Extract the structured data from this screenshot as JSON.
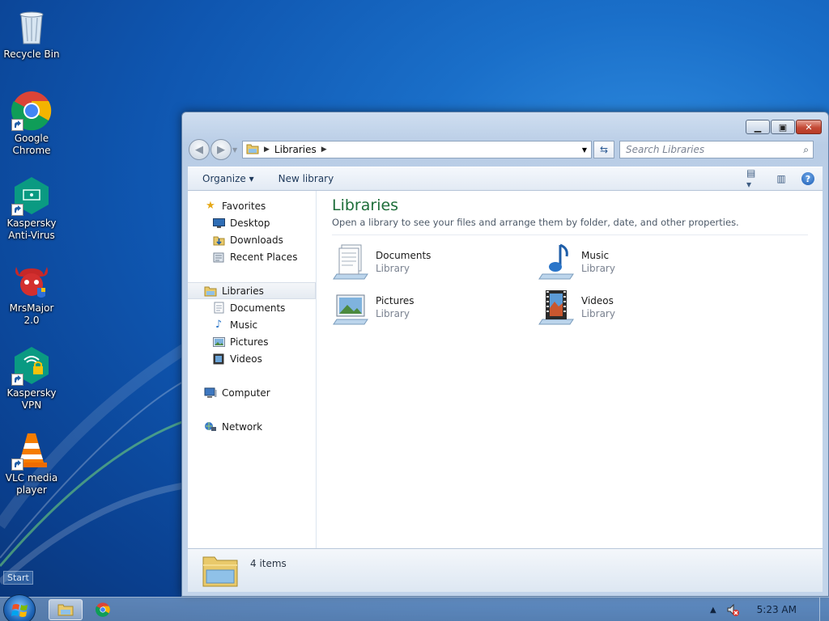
{
  "desktop": {
    "icons": [
      {
        "label": "Recycle Bin",
        "icon": "recycle-bin-icon"
      },
      {
        "label": "Google Chrome",
        "icon": "chrome-icon"
      },
      {
        "label": "Kaspersky Anti-Virus",
        "icon": "kaspersky-antivirus-icon"
      },
      {
        "label": "MrsMajor 2.0",
        "icon": "mrsmajor-icon"
      },
      {
        "label": "Kaspersky VPN",
        "icon": "kaspersky-vpn-icon"
      },
      {
        "label": "VLC media player",
        "icon": "vlc-icon"
      }
    ],
    "start_tooltip": "Start"
  },
  "window": {
    "address": {
      "crumb": "Libraries"
    },
    "search": {
      "placeholder": "Search Libraries"
    },
    "toolbar": {
      "organize": "Organize",
      "new_library": "New library"
    },
    "nav": {
      "favorites": {
        "label": "Favorites",
        "items": [
          "Desktop",
          "Downloads",
          "Recent Places"
        ]
      },
      "libraries": {
        "label": "Libraries",
        "items": [
          "Documents",
          "Music",
          "Pictures",
          "Videos"
        ]
      },
      "computer": "Computer",
      "network": "Network"
    },
    "content": {
      "title": "Libraries",
      "description": "Open a library to see your files and arrange them by folder, date, and other properties.",
      "libraries": [
        {
          "name": "Documents",
          "type": "Library",
          "icon": "documents-library-icon"
        },
        {
          "name": "Music",
          "type": "Library",
          "icon": "music-library-icon"
        },
        {
          "name": "Pictures",
          "type": "Library",
          "icon": "pictures-library-icon"
        },
        {
          "name": "Videos",
          "type": "Library",
          "icon": "videos-library-icon"
        }
      ]
    },
    "status": {
      "count": "4 items"
    }
  },
  "taskbar": {
    "apps": [
      {
        "icon": "windows-explorer-icon",
        "active": true
      },
      {
        "icon": "chrome-icon",
        "active": false
      }
    ],
    "clock": "5:23 AM"
  },
  "colors": {
    "accent_title": "#1e6e3a",
    "close_button": "#c44a36",
    "desktop_blue": "#1a6fc9"
  }
}
